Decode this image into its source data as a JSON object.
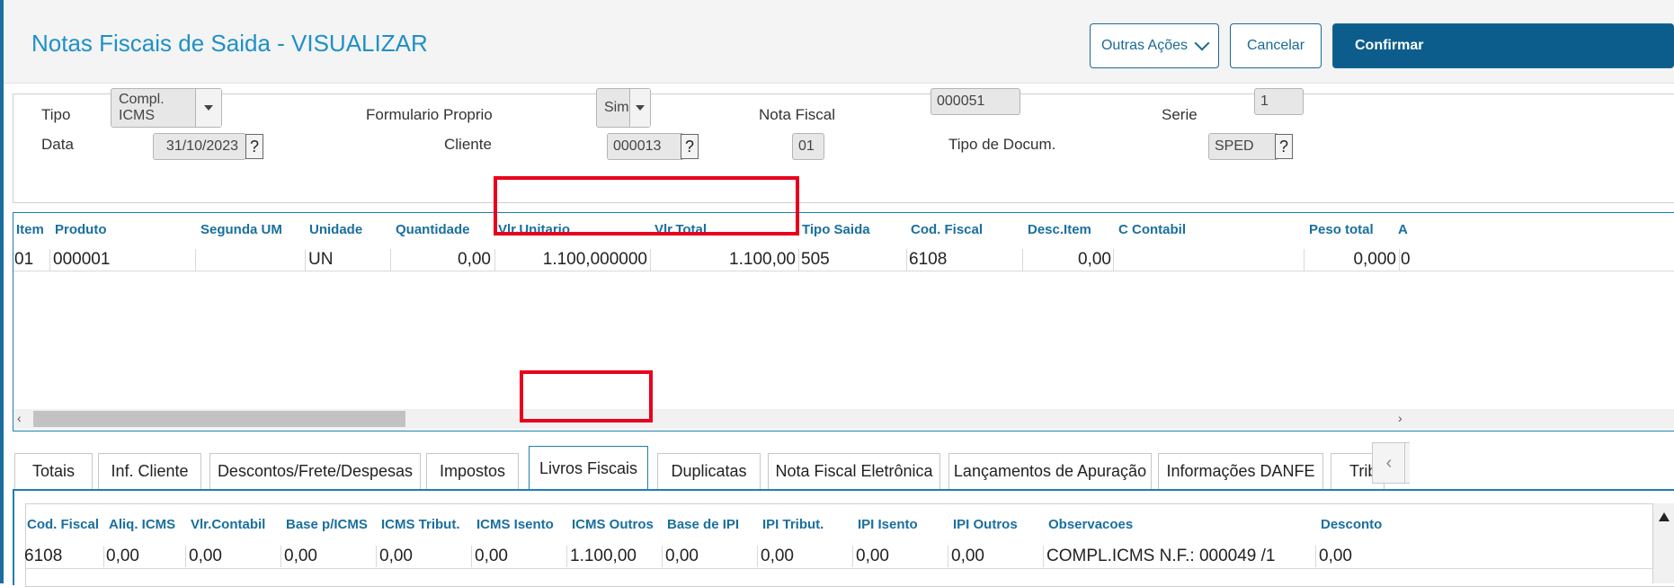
{
  "header": {
    "title": "Notas Fiscais de Saida - VISUALIZAR",
    "outras_acoes": "Outras Ações",
    "cancelar": "Cancelar",
    "confirmar": "Confirmar"
  },
  "form": {
    "tipo_label": "Tipo",
    "tipo_value": "Compl.  ICMS",
    "formulario_label": "Formulario Proprio",
    "formulario_value": "Sim",
    "nota_label": "Nota Fiscal",
    "nota_value": "000051",
    "serie_label": "Serie",
    "serie_value": "1",
    "data_label": "Data",
    "data_value": "31/10/2023",
    "cliente_label": "Cliente",
    "cliente_value": "000013",
    "loja_value": "01",
    "tipo_doc_label": "Tipo de Docum.",
    "tipo_doc_value": "SPED",
    "lookup_symbol": "?"
  },
  "items_grid": {
    "columns": [
      "Item",
      "Produto",
      "Segunda UM",
      "Unidade",
      "Quantidade",
      "Vlr.Unitario",
      "Vlr.Total",
      "Tipo Saida",
      "Cod. Fiscal",
      "Desc.Item",
      "C Contabil",
      "Peso total",
      "A"
    ],
    "row": {
      "item": "01",
      "produto": "000001",
      "segunda_um": "",
      "unidade": "UN",
      "quantidade": "0,00",
      "vlr_unitario": "1.100,000000",
      "vlr_total": "1.100,00",
      "tipo_saida": "505",
      "cod_fiscal": "6108",
      "desc_item": "0,00",
      "c_contabil": "",
      "peso_total": "0,000",
      "a": "0"
    }
  },
  "tabs": [
    "Totais",
    "Inf. Cliente",
    "Descontos/Frete/Despesas",
    "Impostos",
    "Livros Fiscais",
    "Duplicatas",
    "Nota Fiscal Eletrônica",
    "Lançamentos de Apuração",
    "Informações DANFE",
    "Trib"
  ],
  "active_tab": "Livros Fiscais",
  "livros_grid": {
    "columns": [
      "Cod. Fiscal",
      "Aliq. ICMS",
      "Vlr.Contabil",
      "Base p/ICMS",
      "ICMS Tribut.",
      "ICMS Isento",
      "ICMS Outros",
      "Base de IPI",
      "IPI Tribut.",
      "IPI Isento",
      "IPI Outros",
      "Observacoes",
      "Desconto"
    ],
    "row": [
      "6108",
      "0,00",
      "0,00",
      "0,00",
      "0,00",
      "0,00",
      "1.100,00",
      "0,00",
      "0,00",
      "0,00",
      "0,00",
      "COMPL.ICMS N.F.: 000049 /1",
      "0,00"
    ]
  },
  "icons": [
    "chevron-down-icon",
    "dropdown-arrow-icon",
    "lookup-icon",
    "scroll-left-icon",
    "scroll-right-icon",
    "scroll-up-icon"
  ]
}
